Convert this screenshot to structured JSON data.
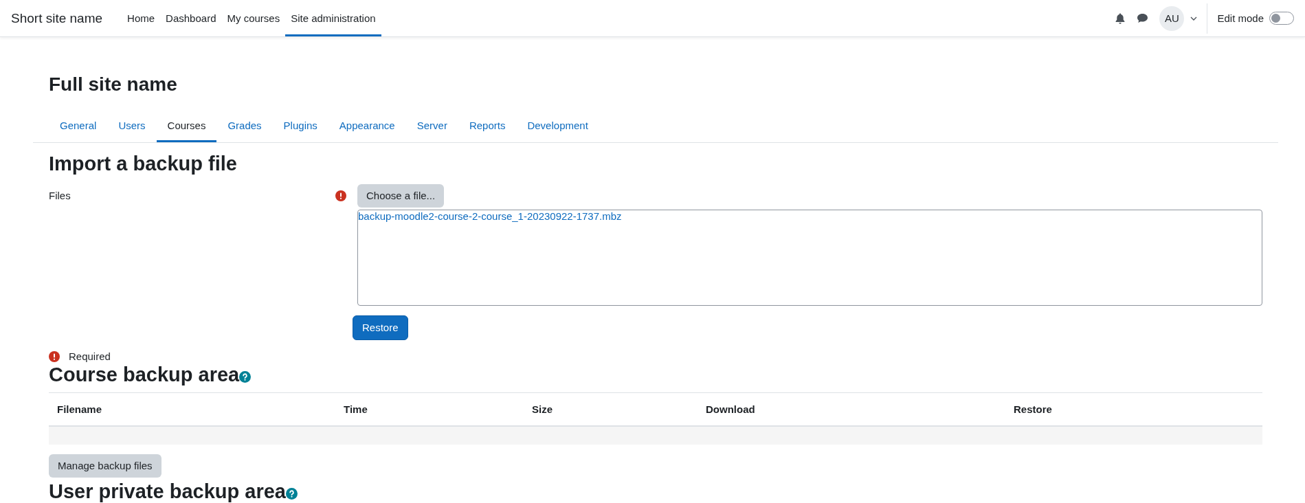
{
  "navbar": {
    "site_name": "Short site name",
    "links": [
      {
        "label": "Home",
        "selected": false
      },
      {
        "label": "Dashboard",
        "selected": false
      },
      {
        "label": "My courses",
        "selected": false
      },
      {
        "label": "Site administration",
        "selected": true
      }
    ],
    "avatar": "AU",
    "edit_mode": {
      "label": "Edit mode",
      "on": false
    }
  },
  "page_title": "Full site name",
  "tabs": [
    {
      "label": "General",
      "selected": false
    },
    {
      "label": "Users",
      "selected": false
    },
    {
      "label": "Courses",
      "selected": true
    },
    {
      "label": "Grades",
      "selected": false
    },
    {
      "label": "Plugins",
      "selected": false
    },
    {
      "label": "Appearance",
      "selected": false
    },
    {
      "label": "Server",
      "selected": false
    },
    {
      "label": "Reports",
      "selected": false
    },
    {
      "label": "Development",
      "selected": false
    }
  ],
  "import": {
    "heading": "Import a backup file",
    "field_label": "Files",
    "required": true,
    "choose_button": "Choose a file...",
    "files": [
      "backup-moodle2-course-2-course_1-20230922-1737.mbz"
    ],
    "submit": "Restore",
    "required_note": "Required"
  },
  "course_backup": {
    "heading": "Course backup area",
    "columns": [
      "Filename",
      "Time",
      "Size",
      "Download",
      "Restore"
    ],
    "manage_button": "Manage backup files"
  },
  "user_backup": {
    "heading": "User private backup area"
  }
}
